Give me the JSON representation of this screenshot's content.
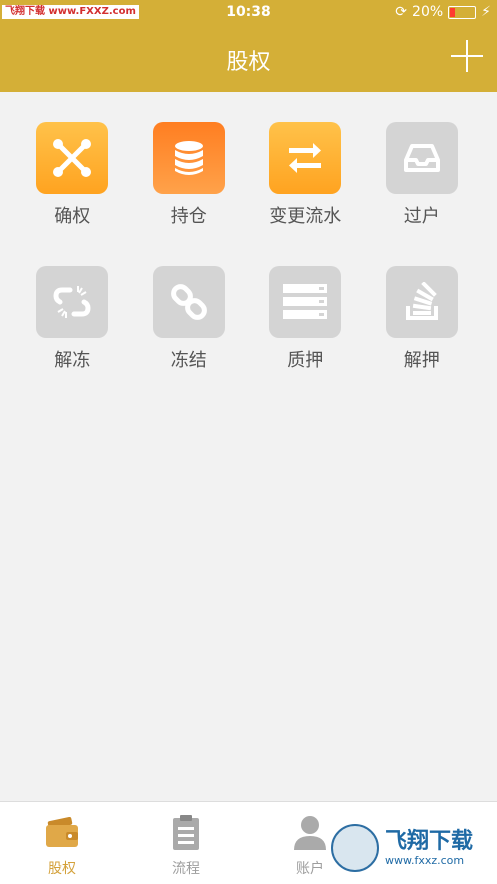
{
  "status_bar": {
    "watermark": "飞翔下载 www.FXXZ.com",
    "time": "10:38",
    "battery": "20%",
    "battery_level": 0.2
  },
  "header": {
    "title": "股权"
  },
  "grid": [
    {
      "label": "确权",
      "icon": "joomla-cross-icon",
      "color": "#ffb030"
    },
    {
      "label": "持仓",
      "icon": "database-icon",
      "color": "#ff8a2a"
    },
    {
      "label": "变更流水",
      "icon": "exchange-arrows-icon",
      "color": "#ffb030"
    },
    {
      "label": "过户",
      "icon": "inbox-tray-icon",
      "color": "#cfcfcf"
    },
    {
      "label": "解冻",
      "icon": "unlink-icon",
      "color": "#cfcfcf"
    },
    {
      "label": "冻结",
      "icon": "chain-link-icon",
      "color": "#cfcfcf"
    },
    {
      "label": "质押",
      "icon": "server-stack-icon",
      "color": "#cfcfcf"
    },
    {
      "label": "解押",
      "icon": "stack-overflow-icon",
      "color": "#cfcfcf"
    }
  ],
  "tabbar": {
    "items": [
      {
        "label": "股权",
        "icon": "wallet-icon",
        "active": true
      },
      {
        "label": "流程",
        "icon": "clipboard-icon",
        "active": false
      },
      {
        "label": "账户",
        "icon": "user-icon",
        "active": false
      }
    ]
  },
  "watermark_logo": {
    "main": "飞翔下载",
    "sub": "www.fxxz.com"
  },
  "colors": {
    "accent": "#d4af37",
    "active_tab": "#d4a13a",
    "inactive_tab": "#9e9e9e"
  }
}
